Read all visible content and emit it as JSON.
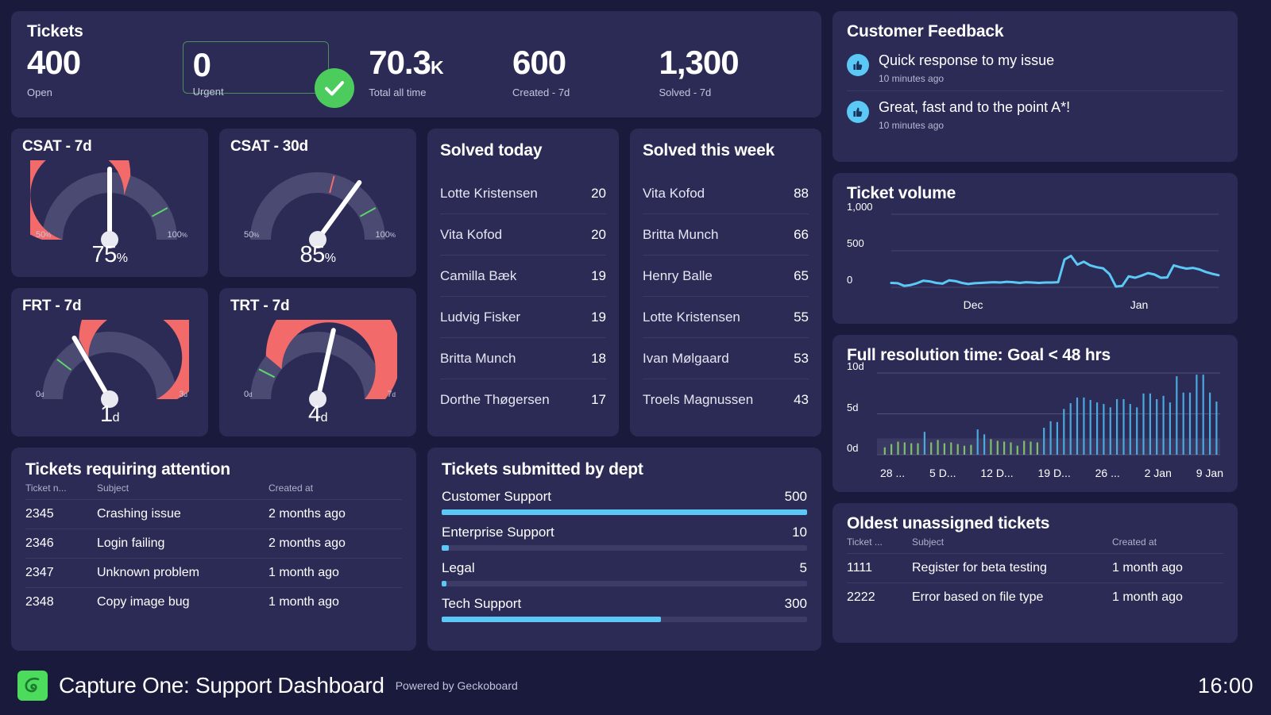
{
  "tickets": {
    "title": "Tickets",
    "kpis": [
      {
        "value": "400",
        "suffix": "",
        "label": "Open",
        "highlight": false
      },
      {
        "value": "0",
        "suffix": "",
        "label": "Urgent",
        "highlight": true
      },
      {
        "value": "70.3",
        "suffix": "K",
        "label": "Total all time",
        "highlight": false
      },
      {
        "value": "600",
        "suffix": "",
        "label": "Created - 7d",
        "highlight": false
      },
      {
        "value": "1,300",
        "suffix": "",
        "label": "Solved - 7d",
        "highlight": false
      }
    ],
    "status_icon": "check-circle-icon",
    "status_color": "#4dcc5e",
    "urgent_border_color": "#4e8d5e"
  },
  "gauges": [
    {
      "title": "CSAT - 7d",
      "min_label": "50",
      "min_unit": "%",
      "max_label": "100",
      "max_unit": "%",
      "value_label": "75",
      "value_unit": "%",
      "min": 50,
      "max": 100,
      "value": 75,
      "band_start": 50,
      "band_end": 80,
      "band_color": "#f26a6a",
      "green_tick": 92,
      "red_tick": null
    },
    {
      "title": "CSAT - 30d",
      "min_label": "50",
      "min_unit": "%",
      "max_label": "100",
      "max_unit": "%",
      "value_label": "85",
      "value_unit": "%",
      "min": 50,
      "max": 100,
      "value": 85,
      "band_start": null,
      "band_end": null,
      "band_color": "#f26a6a",
      "green_tick": 92,
      "red_tick": 79
    },
    {
      "title": "FRT - 7d",
      "min_label": "0",
      "min_unit": "d",
      "max_label": "3",
      "max_unit": "d",
      "value_label": "1",
      "value_unit": "d",
      "min": 0,
      "max": 3,
      "value": 1,
      "band_start": 1.05,
      "band_end": 3,
      "band_color": "#f26a6a",
      "green_tick": 0.62,
      "red_tick": null
    },
    {
      "title": "TRT - 7d",
      "min_label": "0",
      "min_unit": "d",
      "max_label": "7",
      "max_unit": "d",
      "value_label": "4",
      "value_unit": "d",
      "min": 0,
      "max": 7,
      "value": 4,
      "band_start": 1.55,
      "band_end": 7,
      "band_color": "#f26a6a",
      "green_tick": 1.05,
      "red_tick": null
    }
  ],
  "solved_today": {
    "title": "Solved today",
    "rows": [
      {
        "name": "Lotte Kristensen",
        "value": "20"
      },
      {
        "name": "Vita Kofod",
        "value": "20"
      },
      {
        "name": "Camilla Bæk",
        "value": "19"
      },
      {
        "name": "Ludvig Fisker",
        "value": "19"
      },
      {
        "name": "Britta Munch",
        "value": "18"
      },
      {
        "name": "Dorthe Thøgersen",
        "value": "17"
      }
    ]
  },
  "solved_week": {
    "title": "Solved this week",
    "rows": [
      {
        "name": "Vita Kofod",
        "value": "88"
      },
      {
        "name": "Britta Munch",
        "value": "66"
      },
      {
        "name": "Henry Balle",
        "value": "65"
      },
      {
        "name": "Lotte Kristensen",
        "value": "55"
      },
      {
        "name": "Ivan Mølgaard",
        "value": "53"
      },
      {
        "name": "Troels Magnussen",
        "value": "43"
      }
    ]
  },
  "tickets_attention": {
    "title": "Tickets requiring attention",
    "columns": [
      "Ticket n...",
      "Subject",
      "Created at"
    ],
    "rows": [
      {
        "id": "2345",
        "subject": "Crashing issue",
        "created": "2 months ago"
      },
      {
        "id": "2346",
        "subject": "Login failing",
        "created": "2 months ago"
      },
      {
        "id": "2347",
        "subject": "Unknown problem",
        "created": "1 month ago"
      },
      {
        "id": "2348",
        "subject": "Copy image bug",
        "created": "1 month ago"
      }
    ]
  },
  "dept": {
    "title": "Tickets submitted by dept",
    "bar_color": "#5bc8f5",
    "chart_data": {
      "type": "bar",
      "title": "Tickets submitted by dept",
      "categories": [
        "Customer Support",
        "Enterprise Support",
        "Legal",
        "Tech Support"
      ],
      "values": [
        500,
        10,
        5,
        300
      ],
      "max": 500,
      "xlabel": "",
      "ylabel": "",
      "grid": false,
      "legend": "none"
    }
  },
  "feedback": {
    "title": "Customer Feedback",
    "items": [
      {
        "icon": "thumbs-up-icon",
        "text": "Quick response to my issue",
        "time": "10 minutes ago"
      },
      {
        "icon": "thumbs-up-icon",
        "text": "Great, fast and to the point A*!",
        "time": "10 minutes ago"
      }
    ]
  },
  "ticket_volume": {
    "title": "Ticket volume",
    "line_color": "#5bc8f5",
    "chart_data": {
      "type": "line",
      "title": "Ticket volume",
      "xlabel": "",
      "ylabel": "",
      "yticks": [
        "0",
        "500",
        "1,000"
      ],
      "ylim": [
        0,
        1000
      ],
      "xticks": [
        "Dec",
        "Jan"
      ],
      "xtick_positions": [
        0.22,
        0.73
      ],
      "grid": true,
      "legend": "none",
      "values": [
        60,
        55,
        20,
        30,
        55,
        90,
        80,
        60,
        50,
        95,
        85,
        60,
        45,
        55,
        60,
        65,
        70,
        65,
        75,
        70,
        60,
        70,
        65,
        60,
        65,
        65,
        70,
        380,
        430,
        310,
        350,
        300,
        275,
        260,
        180,
        10,
        20,
        150,
        130,
        160,
        195,
        175,
        130,
        135,
        300,
        275,
        255,
        265,
        245,
        210,
        185,
        165
      ]
    }
  },
  "resolution": {
    "title": "Full resolution time: Goal < 48 hrs",
    "chart_data": {
      "type": "bar",
      "title": "Full resolution time: Goal < 48 hrs",
      "xlabel": "",
      "ylabel": "",
      "yticks": [
        "0d",
        "5d",
        "10d"
      ],
      "ylim": [
        0,
        10
      ],
      "xticks": [
        "28 ...",
        "5 D...",
        "12 D...",
        "19 D...",
        "26 ...",
        "2 Jan",
        "9 Jan"
      ],
      "grid": true,
      "legend": "none",
      "goal_band": [
        0,
        2
      ],
      "goal_band_color": "#3f3f69",
      "bar_color_under": "#7dbf6a",
      "bar_color_over": "#4aa9dd",
      "values": [
        0.9,
        1.3,
        1.6,
        1.5,
        1.4,
        1.4,
        2.8,
        1.5,
        1.8,
        1.4,
        1.5,
        1.3,
        1.1,
        1.2,
        3.1,
        2.5,
        1.9,
        1.7,
        1.6,
        1.5,
        1.1,
        1.7,
        1.6,
        1.5,
        3.3,
        4.1,
        4.0,
        5.6,
        6.3,
        7.0,
        7.0,
        6.7,
        6.4,
        6.2,
        5.8,
        6.8,
        6.8,
        6.2,
        5.8,
        7.5,
        7.5,
        6.8,
        7.2,
        6.4,
        9.6,
        7.6,
        7.6,
        9.8,
        9.8,
        7.6,
        6.5
      ]
    }
  },
  "oldest": {
    "title": "Oldest unassigned tickets",
    "columns": [
      "Ticket ...",
      "Subject",
      "Created at"
    ],
    "rows": [
      {
        "id": "1111",
        "subject": "Register for beta testing",
        "created": "1 month ago"
      },
      {
        "id": "2222",
        "subject": "Error based on file type",
        "created": "1 month ago"
      }
    ]
  },
  "footer": {
    "logo_icon": "capture-one-logo-icon",
    "logo_color": "#4ddb5e",
    "title": "Capture One: Support Dashboard",
    "powered_by": "Powered by Geckoboard",
    "clock": "16:00"
  }
}
